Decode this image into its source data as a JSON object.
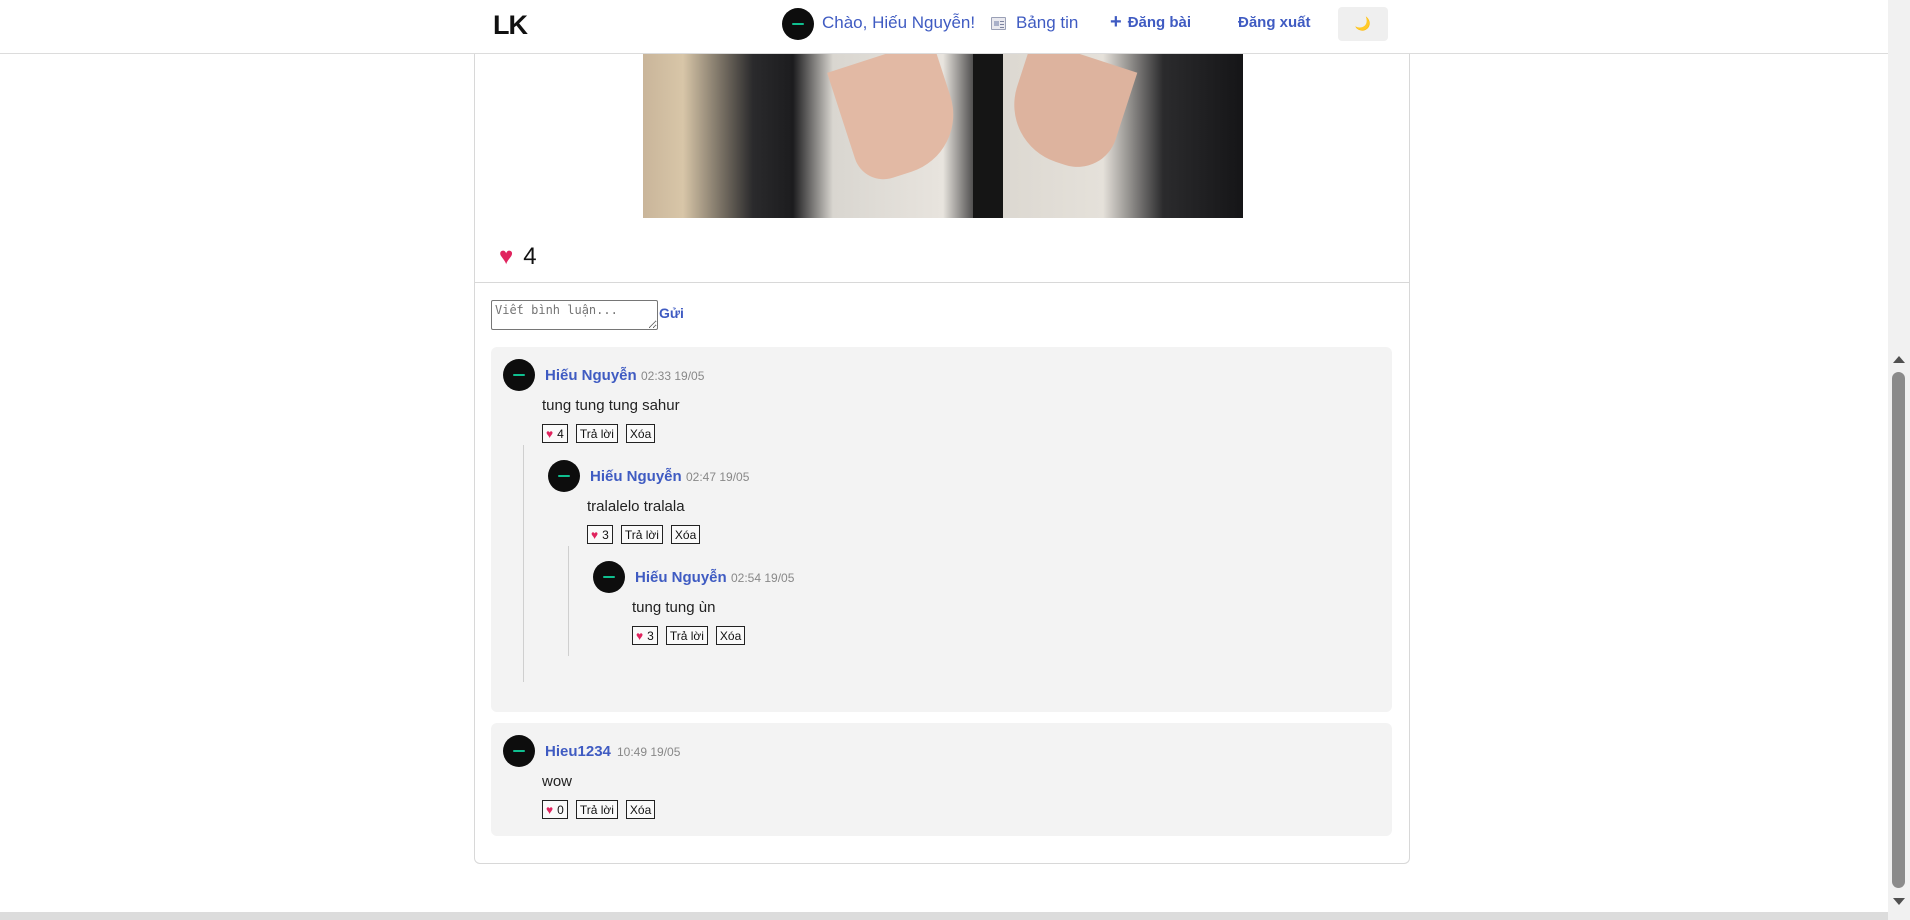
{
  "nav": {
    "logo": "LK",
    "greeting": "Chào, Hiếu Nguyễn!",
    "news_label": "Bảng tin",
    "post_label": "Đăng bài",
    "plus_icon": "+",
    "logout_label": "Đăng xuất",
    "theme_icon": "🌙"
  },
  "post": {
    "like_count": "4",
    "heart_icon": "♥"
  },
  "comment_input": {
    "placeholder": "Viết bình luận...",
    "send_label": "Gửi"
  },
  "comments": [
    {
      "author": "Hiếu Nguyễn",
      "time": "02:33 19/05",
      "text": "tung tung tung sahur",
      "likes": "4",
      "reply_label": "Trả lời",
      "delete_label": "Xóa",
      "replies": [
        {
          "author": "Hiếu Nguyễn",
          "time": "02:47 19/05",
          "text": "tralalelo tralala",
          "likes": "3",
          "reply_label": "Trả lời",
          "delete_label": "Xóa",
          "replies": [
            {
              "author": "Hiếu Nguyễn",
              "time": "02:54 19/05",
              "text": "tung tung ùn",
              "likes": "3",
              "reply_label": "Trả lời",
              "delete_label": "Xóa"
            }
          ]
        }
      ]
    },
    {
      "author": "Hieu1234",
      "time": "10:49 19/05",
      "text": "wow",
      "likes": "0",
      "reply_label": "Trả lời",
      "delete_label": "Xóa"
    }
  ],
  "colors": {
    "accent": "#3f5bc2",
    "heart": "#e0245e",
    "comment_bg": "#f3f3f3"
  }
}
